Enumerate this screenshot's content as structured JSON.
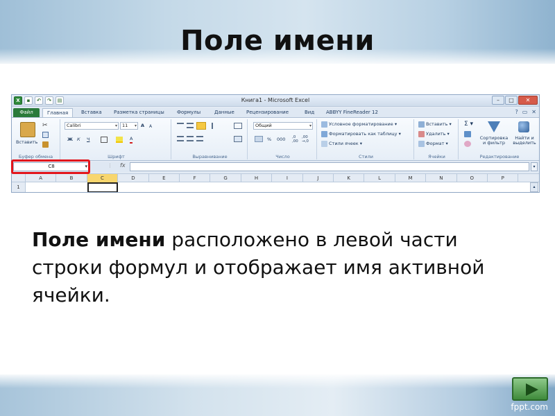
{
  "slide": {
    "title": "Поле имени",
    "description_bold": "Поле имени",
    "description_rest": " расположено в левой части строки формул и отображает имя активной ячейки.",
    "watermark": "fppt.com"
  },
  "excel": {
    "window_title": "Книга1 - Microsoft Excel",
    "tabs": [
      "Файл",
      "Главная",
      "Вставка",
      "Разметка страницы",
      "Формулы",
      "Данные",
      "Рецензирование",
      "Вид",
      "ABBYY FineReader 12"
    ],
    "active_tab": "Главная",
    "groups": {
      "clipboard": "Буфер обмена",
      "font": "Шрифт",
      "alignment": "Выравнивание",
      "number": "Число",
      "styles": "Стили",
      "cells": "Ячейки",
      "editing": "Редактирование"
    },
    "buttons": {
      "paste": "Вставить",
      "font_name": "Calibri",
      "font_size": "11",
      "bold": "Ж",
      "italic": "К",
      "underline": "Ч",
      "number_format": "Общий",
      "conditional_format": "Условное форматирование",
      "format_as_table": "Форматировать как таблицу",
      "cell_styles": "Стили ячеек",
      "insert": "Вставить",
      "delete": "Удалить",
      "format": "Формат",
      "sort_filter": "Сортировка и фильтр",
      "find_select": "Найти и выделить"
    },
    "name_box": "C8",
    "fx": "fx",
    "columns": [
      "A",
      "B",
      "C",
      "D",
      "E",
      "F",
      "G",
      "H",
      "I",
      "J",
      "K",
      "L",
      "M",
      "N",
      "O",
      "P"
    ],
    "selected_column": "C",
    "row_number": "1"
  }
}
